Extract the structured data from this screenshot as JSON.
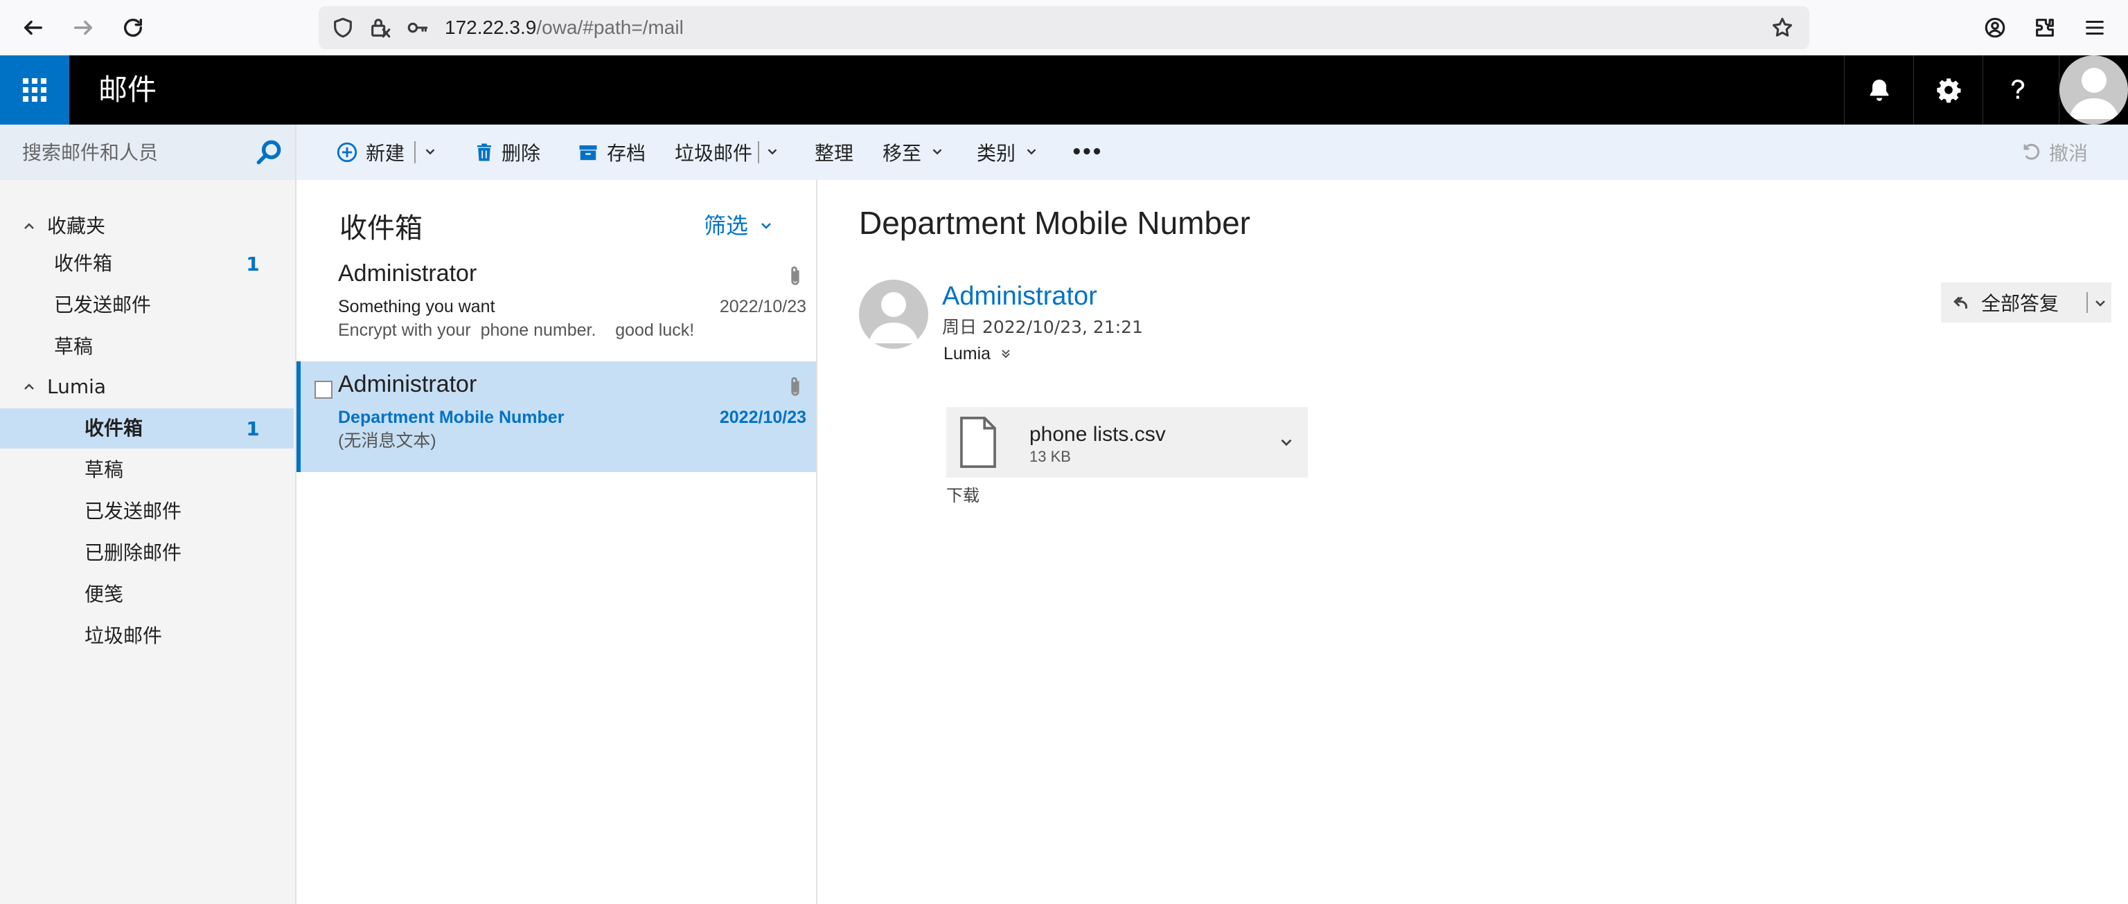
{
  "browser": {
    "url_host": "172.22.3.9",
    "url_path": "/owa/#path=/mail"
  },
  "header": {
    "app_title": "邮件"
  },
  "search": {
    "placeholder": "搜索邮件和人员"
  },
  "nav": {
    "favorites": {
      "label": "收藏夹",
      "items": [
        {
          "label": "收件箱",
          "count": "1"
        },
        {
          "label": "已发送邮件"
        },
        {
          "label": "草稿"
        }
      ]
    },
    "mailbox": {
      "label": "Lumia",
      "items": [
        {
          "label": "收件箱",
          "count": "1"
        },
        {
          "label": "草稿"
        },
        {
          "label": "已发送邮件"
        },
        {
          "label": "已删除邮件"
        },
        {
          "label": "便笺"
        },
        {
          "label": "垃圾邮件"
        }
      ]
    }
  },
  "toolbar": {
    "new_label": "新建",
    "delete_label": "删除",
    "archive_label": "存档",
    "junk_label": "垃圾邮件",
    "sweep_label": "整理",
    "move_label": "移至",
    "category_label": "类别",
    "more_label": "•••",
    "undo_label": "撤消"
  },
  "message_list": {
    "title": "收件箱",
    "filter_label": "筛选",
    "messages": [
      {
        "sender": "Administrator",
        "subject": "Something you want",
        "date": "2022/10/23",
        "preview": "Encrypt with your  phone number.    good luck!",
        "has_attachment": true,
        "selected": false
      },
      {
        "sender": "Administrator",
        "subject": "Department Mobile Number",
        "date": "2022/10/23",
        "preview": "(无消息文本)",
        "has_attachment": true,
        "selected": true
      }
    ]
  },
  "reading_pane": {
    "subject": "Department Mobile Number",
    "sender": "Administrator",
    "sent_time": "周日 2022/10/23, 21:21",
    "recipient": "Lumia",
    "reply_all_label": "全部答复",
    "attachment": {
      "name": "phone lists.csv",
      "size": "13 KB"
    },
    "download_label": "下载"
  },
  "colors": {
    "accent": "#0072c6",
    "selected_bg": "#c7dff5",
    "header_bg": "#000000",
    "command_bar_bg": "#eaf1fa"
  }
}
